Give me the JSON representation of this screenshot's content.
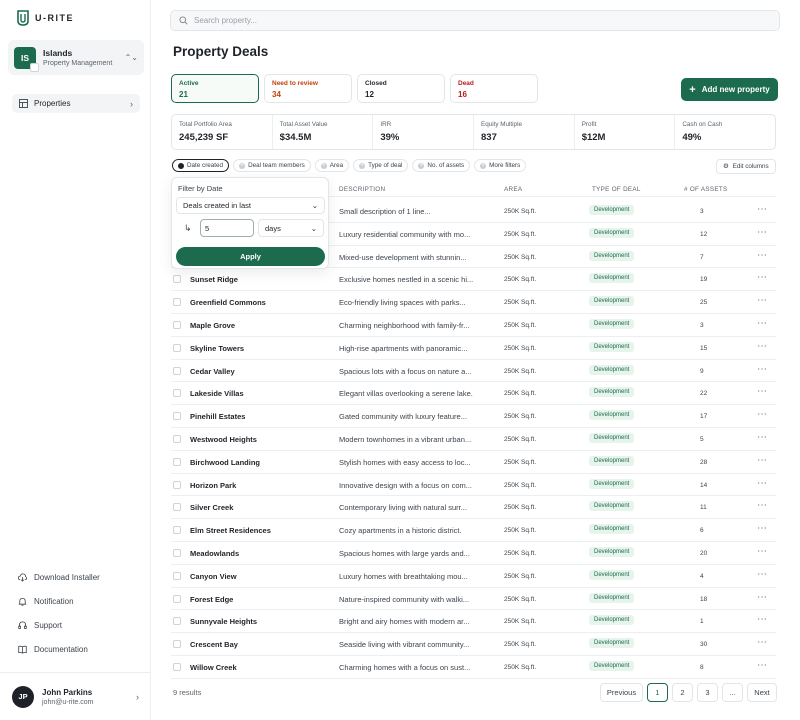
{
  "app": {
    "logo_text": "U-RITE"
  },
  "workspace": {
    "initials": "IS",
    "name": "Islands",
    "subtitle": "Property Management"
  },
  "sidebar": {
    "nav": [
      {
        "label": "Properties",
        "icon": "table-icon"
      }
    ],
    "bottom_links": [
      {
        "label": "Download Installer",
        "icon": "cloud-download-icon"
      },
      {
        "label": "Notification",
        "icon": "bell-icon"
      },
      {
        "label": "Support",
        "icon": "headset-icon"
      },
      {
        "label": "Documentation",
        "icon": "book-icon"
      }
    ],
    "user": {
      "initials": "JP",
      "name": "John Parkins",
      "email": "john@u-rite.com"
    }
  },
  "search": {
    "placeholder": "Search property..."
  },
  "page": {
    "title": "Property Deals"
  },
  "status_tabs": [
    {
      "label": "Active",
      "count": "21"
    },
    {
      "label": "Need to review",
      "count": "34"
    },
    {
      "label": "Closed",
      "count": "12"
    },
    {
      "label": "Dead",
      "count": "16"
    }
  ],
  "add_button": {
    "label": "Add new property"
  },
  "kpis": [
    {
      "label": "Total Portfolio Area",
      "value": "245,239 SF"
    },
    {
      "label": "Total Asset Value",
      "value": "$34.5M"
    },
    {
      "label": "IRR",
      "value": "39%"
    },
    {
      "label": "Equity Multiple",
      "value": "837"
    },
    {
      "label": "Profit",
      "value": "$12M"
    },
    {
      "label": "Cash on Cash",
      "value": "49%"
    }
  ],
  "filters": [
    "Date created",
    "Deal team members",
    "Area",
    "Type of deal",
    "No. of assets",
    "More filters"
  ],
  "edit_columns": "Edit columns",
  "columns": {
    "description": "DESCRIPTION",
    "area": "AREA",
    "type": "TYPE OF DEAL",
    "assets": "# OF ASSETS"
  },
  "date_filter": {
    "title": "Filter by Date",
    "mode": "Deals created in last",
    "amount": "5",
    "unit": "days",
    "apply": "Apply"
  },
  "rows": [
    {
      "name": "",
      "description": "Small description of 1 line...",
      "area": "250K Sq.ft.",
      "type": "Development",
      "assets": "3"
    },
    {
      "name": "",
      "description": "Luxury residential community with mo...",
      "area": "250K Sq.ft.",
      "type": "Development",
      "assets": "12"
    },
    {
      "name": "",
      "description": "Mixed-use development with stunnin...",
      "area": "250K Sq.ft.",
      "type": "Development",
      "assets": "7"
    },
    {
      "name": "Sunset Ridge",
      "description": "Exclusive homes nestled in a scenic hi...",
      "area": "250K Sq.ft.",
      "type": "Development",
      "assets": "19"
    },
    {
      "name": "Greenfield Commons",
      "description": "Eco-friendly living spaces with parks...",
      "area": "250K Sq.ft.",
      "type": "Development",
      "assets": "25"
    },
    {
      "name": "Maple Grove",
      "description": "Charming neighborhood with family-fr...",
      "area": "250K Sq.ft.",
      "type": "Development",
      "assets": "3"
    },
    {
      "name": "Skyline Towers",
      "description": "High-rise apartments with panoramic...",
      "area": "250K Sq.ft.",
      "type": "Development",
      "assets": "15"
    },
    {
      "name": "Cedar Valley",
      "description": "Spacious lots with a focus on nature a...",
      "area": "250K Sq.ft.",
      "type": "Development",
      "assets": "9"
    },
    {
      "name": "Lakeside Villas",
      "description": "Elegant villas overlooking a serene lake.",
      "area": "250K Sq.ft.",
      "type": "Development",
      "assets": "22"
    },
    {
      "name": "Pinehill Estates",
      "description": "Gated community with luxury feature...",
      "area": "250K Sq.ft.",
      "type": "Development",
      "assets": "17"
    },
    {
      "name": "Westwood Heights",
      "description": "Modern townhomes in a vibrant urban...",
      "area": "250K Sq.ft.",
      "type": "Development",
      "assets": "5"
    },
    {
      "name": "Birchwood Landing",
      "description": "Stylish homes with easy access to loc...",
      "area": "250K Sq.ft.",
      "type": "Development",
      "assets": "28"
    },
    {
      "name": "Horizon Park",
      "description": "Innovative design with a focus on com...",
      "area": "250K Sq.ft.",
      "type": "Development",
      "assets": "14"
    },
    {
      "name": "Silver Creek",
      "description": "Contemporary living with natural surr...",
      "area": "250K Sq.ft.",
      "type": "Development",
      "assets": "11"
    },
    {
      "name": "Elm Street Residences",
      "description": "Cozy apartments in a historic district.",
      "area": "250K Sq.ft.",
      "type": "Development",
      "assets": "6"
    },
    {
      "name": "Meadowlands",
      "description": "Spacious homes with large yards and...",
      "area": "250K Sq.ft.",
      "type": "Development",
      "assets": "20"
    },
    {
      "name": "Canyon View",
      "description": "Luxury homes with breathtaking mou...",
      "area": "250K Sq.ft.",
      "type": "Development",
      "assets": "4"
    },
    {
      "name": "Forest Edge",
      "description": "Nature-inspired community with walki...",
      "area": "250K Sq.ft.",
      "type": "Development",
      "assets": "18"
    },
    {
      "name": "Sunnyvale Heights",
      "description": "Bright and airy homes with modern ar...",
      "area": "250K Sq.ft.",
      "type": "Development",
      "assets": "1"
    },
    {
      "name": "Crescent Bay",
      "description": "Seaside living with vibrant community...",
      "area": "250K Sq.ft.",
      "type": "Development",
      "assets": "30"
    },
    {
      "name": "Willow Creek",
      "description": "Charming homes with a focus on sust...",
      "area": "250K Sq.ft.",
      "type": "Development",
      "assets": "8"
    }
  ],
  "footer": {
    "results": "9 results",
    "pagination": [
      "Previous",
      "1",
      "2",
      "3",
      "...",
      "Next"
    ]
  },
  "colors": {
    "accent": "#1c6b4f",
    "review": "#c2410c",
    "dead": "#b91c1c"
  }
}
